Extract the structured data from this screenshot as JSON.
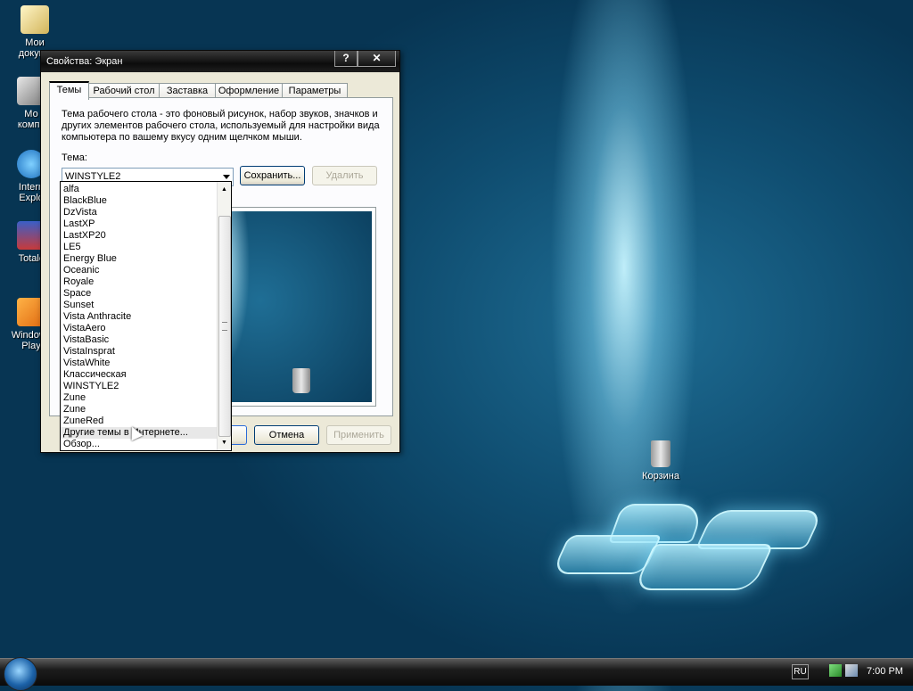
{
  "desktop": {
    "icons": [
      {
        "label": "Мои\nдокуме"
      },
      {
        "label": "Мо\nкомпь"
      },
      {
        "label": "Intern\nExplo"
      },
      {
        "label": "Totalc"
      },
      {
        "label": "Windows\nPlay"
      }
    ],
    "recycle_bin": "Корзина"
  },
  "dialog": {
    "title": "Свойства: Экран",
    "help_btn": "?",
    "close_btn": "✕",
    "tabs": [
      "Темы",
      "Рабочий стол",
      "Заставка",
      "Оформление",
      "Параметры"
    ],
    "description": "Тема рабочего стола - это фоновый рисунок, набор звуков, значков и других элементов рабочего стола, используемый для настройки вида компьютера по вашему вкусу одним щелчком мыши.",
    "theme_label": "Тема:",
    "theme_value": "WINSTYLE2",
    "save_btn": "Сохранить...",
    "delete_btn": "Удалить",
    "cancel_btn": "Отмена",
    "apply_btn": "Применить",
    "preview_close": "✕",
    "theme_options": [
      "alfa",
      "BlackBlue",
      "DzVista",
      "LastXP",
      "LastXP20",
      "LE5",
      "Energy Blue",
      "Oceanic",
      "Royale",
      "Space",
      "Sunset",
      "Vista Anthracite",
      "VistaAero",
      "VistaBasic",
      "VistaInsprat",
      "VistaWhite",
      "Классическая",
      "WINSTYLE2",
      "Zune",
      "Zune",
      "ZuneRed",
      "Другие темы в Интернете...",
      "Обзор..."
    ],
    "hovered_option": "Другие темы в Интернете..."
  },
  "taskbar": {
    "language": "RU",
    "clock": "7:00 PM"
  }
}
